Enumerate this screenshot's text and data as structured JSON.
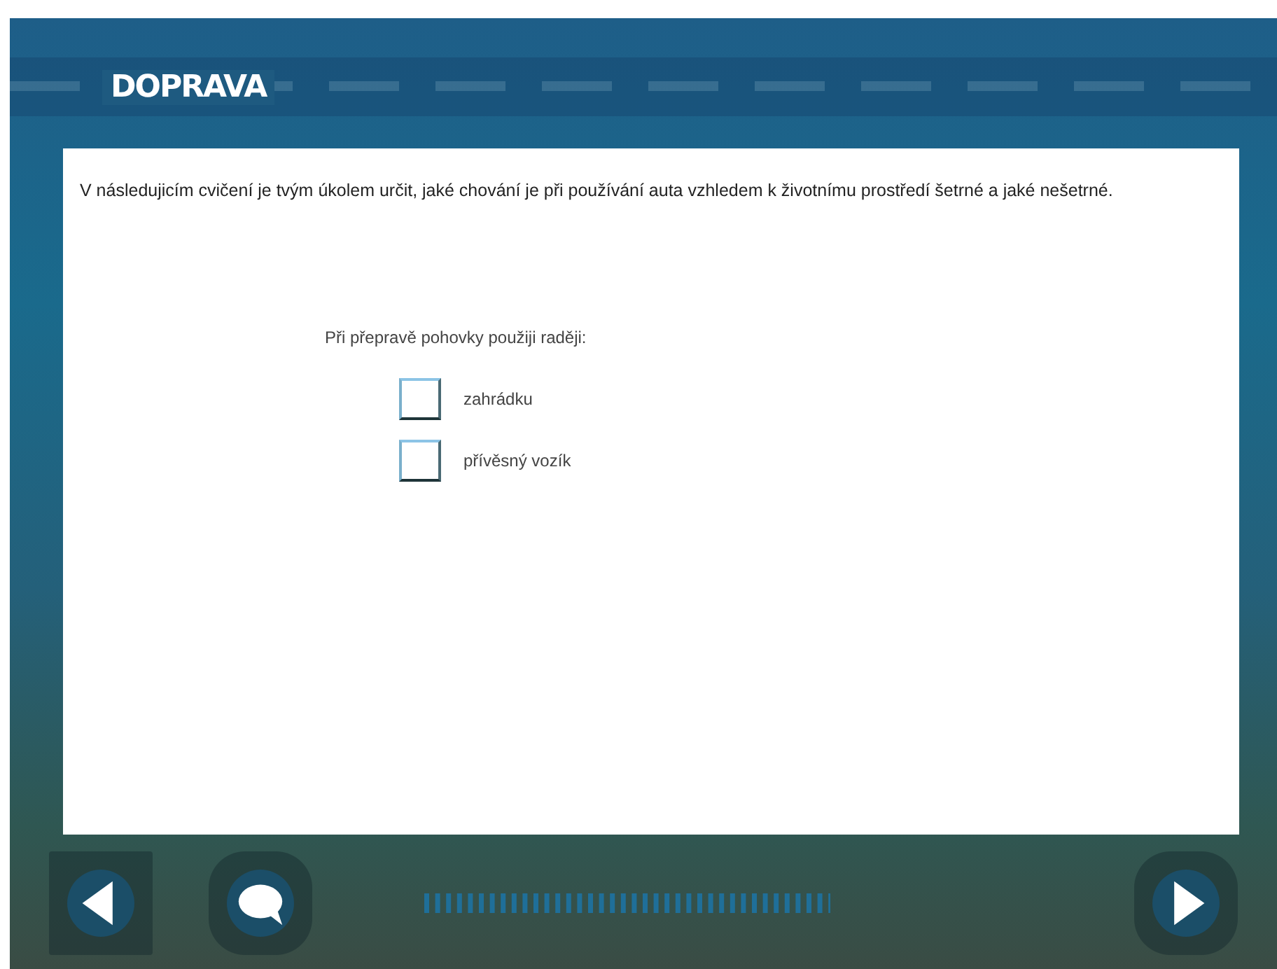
{
  "header": {
    "title": "DOPRAVA"
  },
  "instructions": "V následujicím cvičení je tvým úkolem určit, jaké chování je při používání auta vzhledem k životnímu prostředí šetrné a jaké nešetrné.",
  "question": "Při přepravě pohovky použiji raději:",
  "options": [
    {
      "label": "zahrádku",
      "checked": false
    },
    {
      "label": "přívěsný vozík",
      "checked": false
    }
  ]
}
